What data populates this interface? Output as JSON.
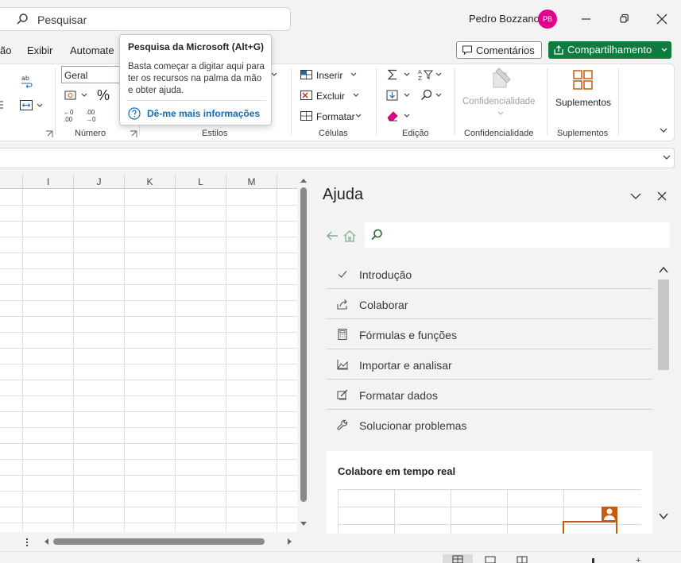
{
  "titlebar": {
    "search_placeholder": "Pesquisar",
    "user_name": "Pedro Bozzano",
    "avatar_initials": "PB",
    "avatar_color": "#e3008c"
  },
  "menu": {
    "items": [
      "ão",
      "Exibir",
      "Automate"
    ],
    "comments_label": "Comentários",
    "share_label": "Compartilhamento",
    "share_color": "#0f7b3f"
  },
  "ribbon": {
    "number_format_value": "Geral",
    "percent_symbol": "%",
    "inc_decimal": "←0 .00",
    "dec_decimal": ".00 →0",
    "group_numero": "Número",
    "group_estilos": "Estilos",
    "cells": {
      "insert": "Inserir",
      "delete": "Excluir",
      "format": "Formatar"
    },
    "group_celulas": "Células",
    "group_edicao": "Edição",
    "sensitivity_button": "Confidencialidade",
    "group_confidencialidade": "Confidencialidade",
    "addins_button": "Suplementos",
    "group_suplementos": "Suplementos"
  },
  "tooltip": {
    "title": "Pesquisa da Microsoft (Alt+G)",
    "body": "Basta começar a digitar aqui para ter os recursos na palma da mão e obter ajuda.",
    "link": "Dê-me mais informações"
  },
  "sheet": {
    "columns": [
      "I",
      "J",
      "K",
      "L",
      "M"
    ]
  },
  "help": {
    "title": "Ajuda",
    "search_placeholder": "",
    "topics": [
      {
        "label": "Introdução",
        "icon": "checkmark-icon"
      },
      {
        "label": "Colaborar",
        "icon": "share-icon"
      },
      {
        "label": "Fórmulas e funções",
        "icon": "calculator-icon"
      },
      {
        "label": "Importar e analisar",
        "icon": "chart-area-icon"
      },
      {
        "label": "Formatar dados",
        "icon": "format-paint-icon"
      },
      {
        "label": "Solucionar problemas",
        "icon": "wrench-icon"
      }
    ],
    "card_title": "Colabore em tempo real",
    "card_accent": "#c55a11"
  }
}
